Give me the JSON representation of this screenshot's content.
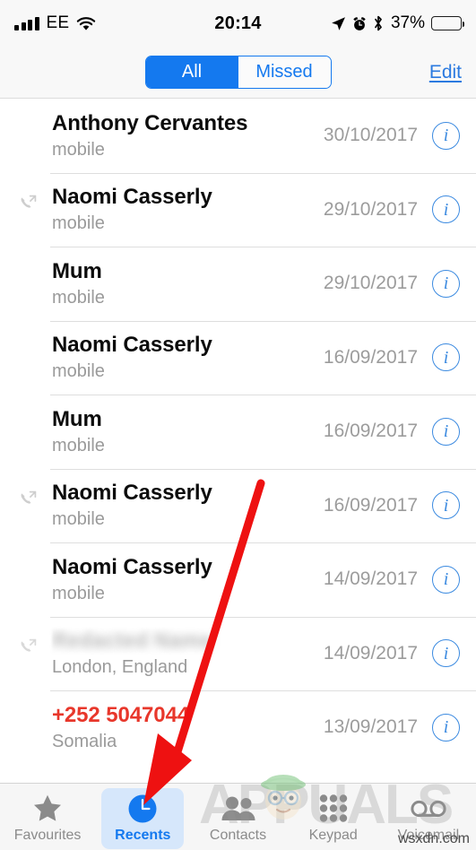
{
  "status_bar": {
    "carrier": "EE",
    "time": "20:14",
    "battery_percent": "37%",
    "icons": [
      "signal-bars-icon",
      "wifi-icon",
      "location-arrow-icon",
      "alarm-clock-icon",
      "bluetooth-icon",
      "battery-icon"
    ]
  },
  "nav_bar": {
    "segments": [
      {
        "label": "All",
        "selected": true
      },
      {
        "label": "Missed",
        "selected": false
      }
    ],
    "edit_label": "Edit"
  },
  "calls": [
    {
      "name": "Anthony Cervantes",
      "subtitle": "mobile",
      "date": "30/10/2017",
      "call_type": "none",
      "missed": false,
      "redacted": false
    },
    {
      "name": "Naomi Casserly",
      "subtitle": "mobile",
      "date": "29/10/2017",
      "call_type": "outgoing",
      "missed": false,
      "redacted": false
    },
    {
      "name": "Mum",
      "subtitle": "mobile",
      "date": "29/10/2017",
      "call_type": "none",
      "missed": false,
      "redacted": false
    },
    {
      "name": "Naomi Casserly",
      "subtitle": "mobile",
      "date": "16/09/2017",
      "call_type": "none",
      "missed": false,
      "redacted": false
    },
    {
      "name": "Mum",
      "subtitle": "mobile",
      "date": "16/09/2017",
      "call_type": "none",
      "missed": false,
      "redacted": false
    },
    {
      "name": "Naomi Casserly",
      "subtitle": "mobile",
      "date": "16/09/2017",
      "call_type": "outgoing",
      "missed": false,
      "redacted": false
    },
    {
      "name": "Naomi Casserly",
      "subtitle": "mobile",
      "date": "14/09/2017",
      "call_type": "none",
      "missed": false,
      "redacted": false
    },
    {
      "name": "Redacted Name",
      "subtitle": "London, England",
      "date": "14/09/2017",
      "call_type": "outgoing",
      "missed": false,
      "redacted": true
    },
    {
      "name": "+252 5047044",
      "subtitle": "Somalia",
      "date": "13/09/2017",
      "call_type": "none",
      "missed": true,
      "redacted": false
    }
  ],
  "info_button_glyph": "i",
  "tab_bar": {
    "tabs": [
      {
        "label": "Favourites",
        "icon": "star-icon",
        "active": false
      },
      {
        "label": "Recents",
        "icon": "clock-icon",
        "active": true
      },
      {
        "label": "Contacts",
        "icon": "people-icon",
        "active": false
      },
      {
        "label": "Keypad",
        "icon": "keypad-icon",
        "active": false
      },
      {
        "label": "Voicemail",
        "icon": "voicemail-icon",
        "active": false
      }
    ]
  },
  "annotation": {
    "type": "red-arrow",
    "points_to": "Recents",
    "color": "#EE1111"
  },
  "watermarks": {
    "brand": "APPUALS",
    "url": "wsxdn.com"
  },
  "colors": {
    "accent_blue": "#1479ef",
    "missed_red": "#e8372b",
    "info_blue": "#3b8ae0",
    "subtitle_gray": "#9a9a9a"
  }
}
